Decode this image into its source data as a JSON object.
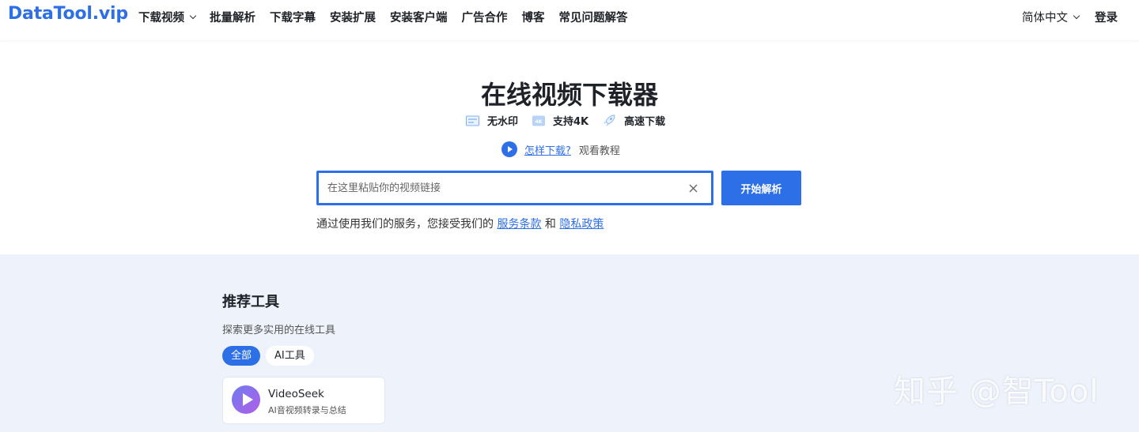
{
  "header": {
    "logo": "DataTool.vip",
    "nav": [
      {
        "label": "下载视频",
        "has_dropdown": true
      },
      {
        "label": "批量解析"
      },
      {
        "label": "下载字幕"
      },
      {
        "label": "安装扩展"
      },
      {
        "label": "安装客户端"
      },
      {
        "label": "广告合作"
      },
      {
        "label": "博客"
      },
      {
        "label": "常见问题解答"
      }
    ],
    "language": "简体中文",
    "login": "登录"
  },
  "hero": {
    "title": "在线视频下载器",
    "features": [
      {
        "icon": "no-watermark-icon",
        "label": "无水印"
      },
      {
        "icon": "4k-icon",
        "label": "支持4K"
      },
      {
        "icon": "rocket-icon",
        "label": "高速下载"
      }
    ],
    "howto_link": "怎样下载?",
    "howto_text": "观看教程",
    "search": {
      "placeholder": "在这里粘贴你的视频链接",
      "value": ""
    },
    "start_button": "开始解析",
    "terms_prefix": "通过使用我们的服务，您接受我们的",
    "terms_link": "服务条款",
    "terms_and": "和",
    "privacy_link": "隐私政策"
  },
  "tools": {
    "title": "推荐工具",
    "subtitle": "探索更多实用的在线工具",
    "tabs": [
      {
        "label": "全部",
        "active": true
      },
      {
        "label": "AI工具",
        "active": false
      }
    ],
    "cards": [
      {
        "name": "VideoSeek",
        "desc": "AI音视频转录与总结",
        "icon": "videoseek-play-icon"
      }
    ]
  },
  "watermark": "知乎 @智Tool",
  "colors": {
    "accent": "#2d6fe6",
    "section_bg": "#eef2fb"
  }
}
